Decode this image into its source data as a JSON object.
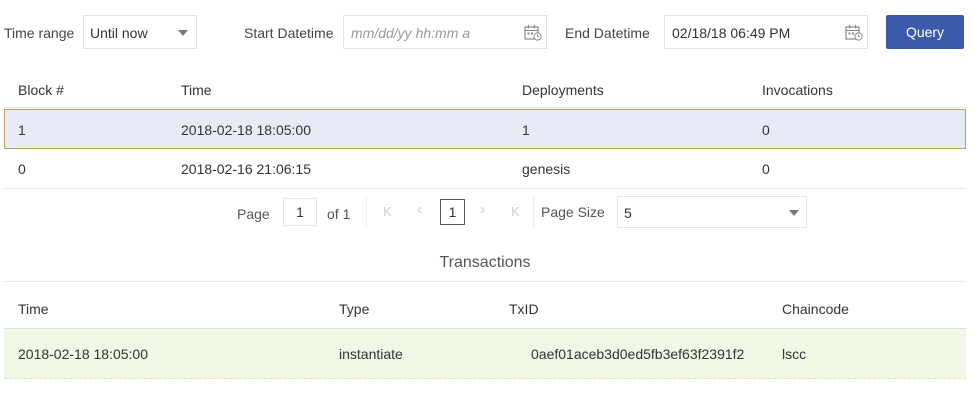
{
  "filters": {
    "time_range_label": "Time range",
    "time_range_value": "Until now",
    "start_label": "Start Datetime",
    "start_placeholder": "mm/dd/yy hh:mm a",
    "end_label": "End Datetime",
    "end_value": "02/18/18 06:49 PM",
    "query_label": "Query"
  },
  "blocks": {
    "headers": [
      "Block #",
      "Time",
      "Deployments",
      "Invocations"
    ],
    "rows": [
      {
        "block": "1",
        "time": "2018-02-18 18:05:00",
        "deployments": "1",
        "invocations": "0"
      },
      {
        "block": "0",
        "time": "2018-02-16 21:06:15",
        "deployments": "genesis",
        "invocations": "0"
      }
    ]
  },
  "pagination": {
    "page_label": "Page",
    "page_value": "1",
    "of_label": "of 1",
    "first_glyph": "K",
    "prev_glyph": "‹",
    "current_page": "1",
    "next_glyph": "›",
    "last_glyph": "K",
    "page_size_label": "Page Size",
    "page_size_value": "5"
  },
  "transactions": {
    "title": "Transactions",
    "headers": [
      "Time",
      "Type",
      "TxID",
      "Chaincode"
    ],
    "rows": [
      {
        "time": "2018-02-18 18:05:00",
        "type": "instantiate",
        "txid": "0aef01aceb3d0ed5fb3ef63f2391f2",
        "chaincode": "lscc"
      }
    ]
  },
  "colors": {
    "accent": "#3b5aa9",
    "selected_row_bg": "#e6ebf5",
    "selected_row_border": "#c79a62",
    "tx_row_bg": "#f1f7e5"
  }
}
